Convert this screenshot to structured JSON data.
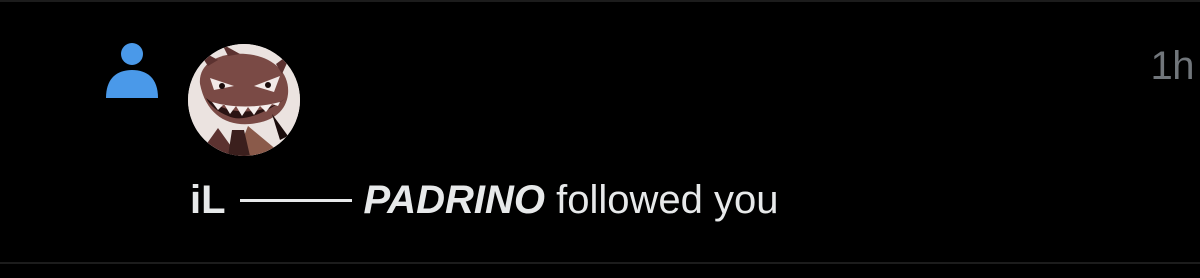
{
  "notification": {
    "type_icon": "person-icon",
    "avatar": "user-avatar",
    "timestamp": "1h",
    "display_name_prefix": "iL",
    "display_name_dash": "——",
    "display_name_main": "PADRINO",
    "action_text": " followed you"
  },
  "colors": {
    "background": "#000000",
    "icon_accent": "#4a99e9",
    "text_primary": "#e7e9ea",
    "text_secondary": "#71767b"
  }
}
